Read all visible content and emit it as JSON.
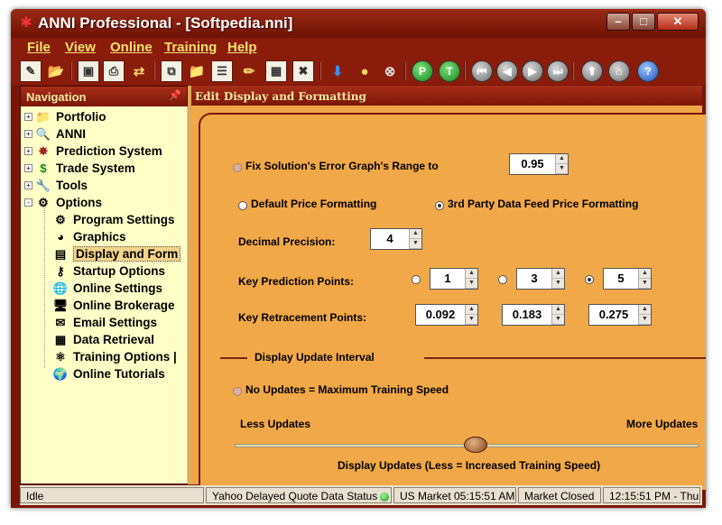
{
  "window": {
    "title": "ANNI Professional - [Softpedia.nni]"
  },
  "menu": {
    "items": [
      "File",
      "View",
      "Online",
      "Training",
      "Help"
    ]
  },
  "toolbar": {
    "round_buttons": [
      "P",
      "T"
    ]
  },
  "navigation": {
    "header": "Navigation",
    "items": [
      {
        "label": "Portfolio",
        "icon": "folder-icon",
        "level": 0,
        "expander": "+"
      },
      {
        "label": "ANNI",
        "icon": "magnifier-icon",
        "level": 0,
        "expander": "+"
      },
      {
        "label": "Prediction System",
        "icon": "network-icon",
        "level": 0,
        "expander": "+"
      },
      {
        "label": "Trade System",
        "icon": "dollar-icon",
        "level": 0,
        "expander": "+"
      },
      {
        "label": "Tools",
        "icon": "wrench-icon",
        "level": 0,
        "expander": "+"
      },
      {
        "label": "Options",
        "icon": "options-icon",
        "level": 0,
        "expander": "-"
      },
      {
        "label": "Program Settings",
        "icon": "gear-icon",
        "level": 1
      },
      {
        "label": "Graphics",
        "icon": "palette-icon",
        "level": 1
      },
      {
        "label": "Display and Form",
        "icon": "table-icon",
        "level": 1,
        "selected": true
      },
      {
        "label": "Startup Options",
        "icon": "key-icon",
        "level": 1
      },
      {
        "label": "Online Settings",
        "icon": "globe-icon",
        "level": 1
      },
      {
        "label": "Online Brokerage",
        "icon": "computer-icon",
        "level": 1
      },
      {
        "label": "Email Settings",
        "icon": "email-icon",
        "level": 1
      },
      {
        "label": "Data Retrieval",
        "icon": "database-icon",
        "level": 1
      },
      {
        "label": "Training Options |",
        "icon": "training-icon",
        "level": 1
      },
      {
        "label": "Online Tutorials",
        "icon": "tutorial-icon",
        "level": 1
      }
    ]
  },
  "content": {
    "header": "Edit Display and Formatting",
    "fix_range_label": "Fix Solution's Error Graph's Range to",
    "fix_range_value": "0.95",
    "default_price_label": "Default Price Formatting",
    "third_party_label": "3rd Party Data Feed Price Formatting",
    "decimal_label": "Decimal Precision:",
    "decimal_value": "4",
    "key_prediction_label": "Key Prediction Points:",
    "key_prediction_values": [
      "1",
      "3",
      "5"
    ],
    "key_retracement_label": "Key Retracement Points:",
    "key_retracement_values": [
      "0.092",
      "0.183",
      "0.275"
    ],
    "display_update_heading": "Display Update Interval",
    "no_updates_label": "No Updates = Maximum Training Speed",
    "less_updates": "Less Updates",
    "more_updates": "More Updates",
    "slider_caption": "Display Updates (Less = Increased Training Speed)",
    "slider_level": 0.52
  },
  "status": {
    "state": "Idle",
    "quote": "Yahoo Delayed Quote Data Status",
    "market_time": "US Market 05:15:51 AM",
    "market_state": "Market Closed",
    "clock": "12:15:51 PM - Thu"
  },
  "colors": {
    "accent": "#7a1608",
    "panel": "#f0a848",
    "menu_text": "#f2e26a"
  }
}
